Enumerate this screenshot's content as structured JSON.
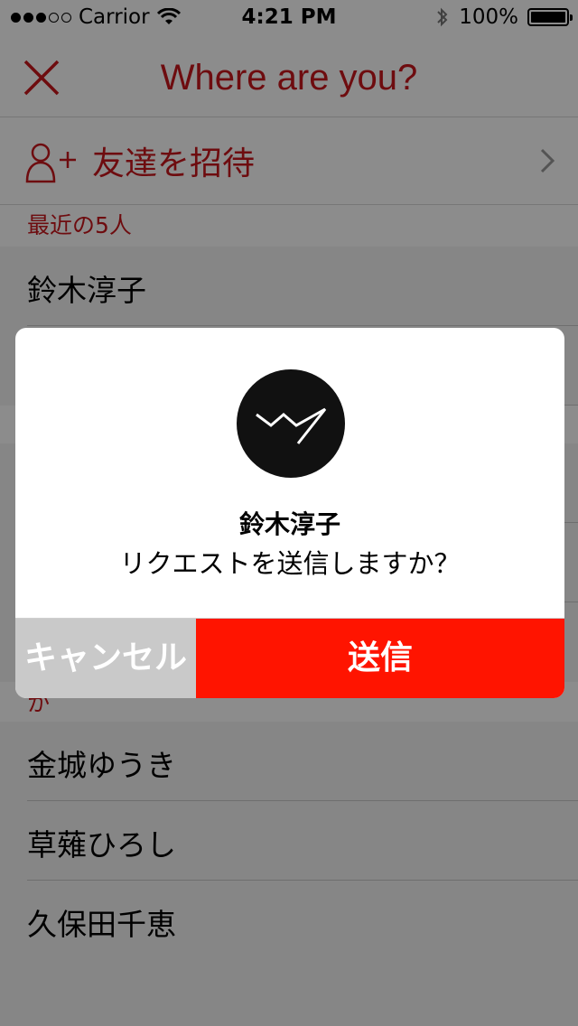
{
  "status_bar": {
    "carrier": "Carrior",
    "time": "4:21 PM",
    "battery": "100%",
    "signal_bars_filled": 3,
    "signal_bars_total": 5
  },
  "nav": {
    "title": "Where are you?",
    "close_icon": "close-icon"
  },
  "invite": {
    "label": "友達を招待",
    "icon": "add-person-icon"
  },
  "sections": {
    "recent": "最近の5人",
    "ka": "か"
  },
  "recent_contacts": [
    "鈴木淳子"
  ],
  "ka_contacts": [
    "金城ゆうき",
    "草薙ひろし",
    "久保田千恵"
  ],
  "dialog": {
    "name": "鈴木淳子",
    "message": "リクエストを送信しますか？",
    "cancel_label": "キャンセル",
    "send_label": "送信"
  },
  "colors": {
    "accent": "#c8161d",
    "send_button": "#ff1400",
    "cancel_button": "#c9c9c9"
  }
}
